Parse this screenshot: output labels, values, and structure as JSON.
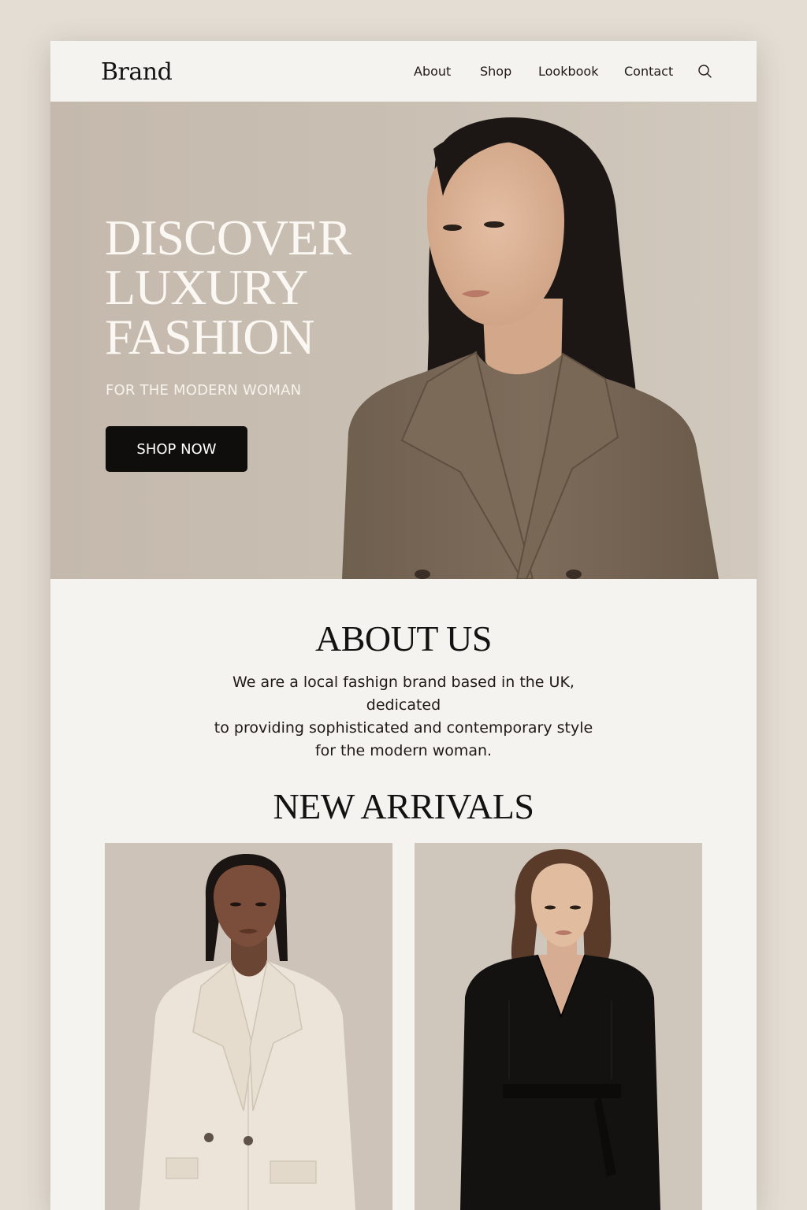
{
  "header": {
    "brand": "Brand",
    "nav": {
      "about": "About",
      "shop": "Shop",
      "lookbook": "Lookbook",
      "contact": "Contact"
    },
    "search_icon": "search-icon"
  },
  "hero": {
    "title_line1": "DISCOVER",
    "title_line2": "LUXURY",
    "title_line3": "FASHION",
    "subtitle": "FOR THE MODERN WOMAN",
    "cta": "SHOP NOW"
  },
  "about": {
    "title": "ABOUT US",
    "line1": "We are a local fashign brand based in the UK, dedicated",
    "line2": "to providing sophisticated and contemporary style",
    "line3": "for the modern woman."
  },
  "arrivals": {
    "title": "NEW ARRIVALS"
  },
  "colors": {
    "page_background": "#e3ddd4",
    "surface": "#f5f3ef",
    "hero_background": "#c9bfb3",
    "button": "#0f0e0c",
    "text": "#141210"
  }
}
